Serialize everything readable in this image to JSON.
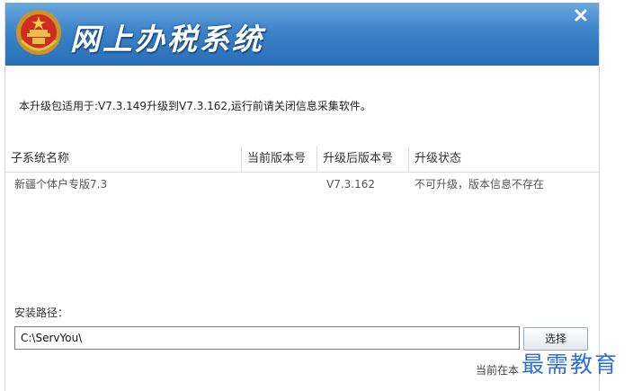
{
  "window": {
    "title": "网上办税系统",
    "close_symbol": "×"
  },
  "notice": "本升级包适用于:V7.3.149升级到V7.3.162,运行前请关闭信息采集软件。",
  "table": {
    "columns": [
      "子系统名称",
      "当前版本号",
      "升级后版本号",
      "升级状态"
    ],
    "rows": [
      {
        "name": "新疆个体户专版7.3",
        "current": "",
        "upgraded": "V7.3.162",
        "status": "不可升级，版本信息不存在"
      }
    ]
  },
  "install": {
    "label": "安装路径：",
    "path": "C:\\ServYou\\",
    "choose_label": "选择"
  },
  "status_text": "当前在本",
  "watermark": "最需教育",
  "colors": {
    "titlebar": "#3c83c9",
    "watermark": "#2f6fd6"
  }
}
